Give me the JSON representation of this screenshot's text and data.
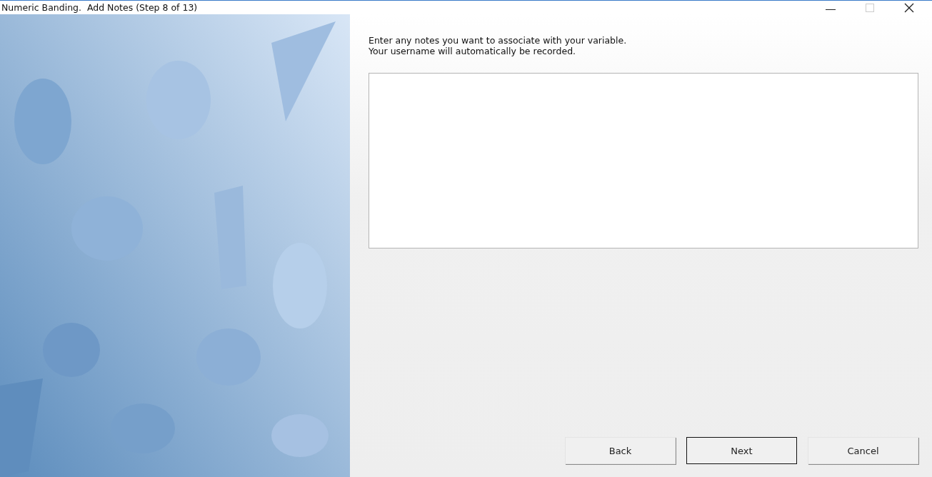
{
  "window": {
    "title": "Numeric Banding.  Add Notes (Step 8 of 13)"
  },
  "side_image": {
    "kind": "picture"
  },
  "instructions": [
    "Enter any notes you want to associate with your variable.",
    "Your username will automatically be recorded."
  ],
  "buttons": [
    {
      "label": "Back",
      "default": false
    },
    {
      "label": "Next",
      "default": true
    },
    {
      "label": "Cancel",
      "default": false
    }
  ]
}
